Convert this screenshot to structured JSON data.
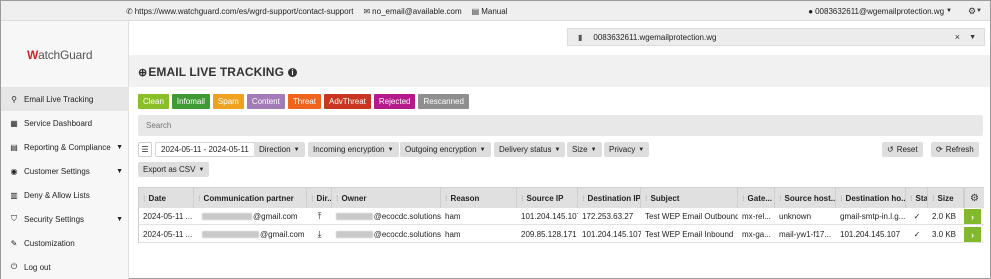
{
  "topbar": {
    "support_link": "https://www.watchguard.com/es/wgrd-support/contact-support",
    "email": "no_email@available.com",
    "manual": "Manual",
    "user": "0083632611@wgemailprotection.wg"
  },
  "logo": {
    "prefix": "W",
    "rest": "atchGuard"
  },
  "tenant": {
    "value": "0083632611.wgemailprotection.wg"
  },
  "sidebar": {
    "items": [
      {
        "label": "Email Live Tracking",
        "icon": "search-icon",
        "caret": false
      },
      {
        "label": "Service Dashboard",
        "icon": "dashboard-icon",
        "caret": false
      },
      {
        "label": "Reporting & Compliance",
        "icon": "reporting-icon",
        "caret": true
      },
      {
        "label": "Customer Settings",
        "icon": "user-settings-icon",
        "caret": true
      },
      {
        "label": "Deny & Allow Lists",
        "icon": "list-icon",
        "caret": false
      },
      {
        "label": "Security Settings",
        "icon": "shield-icon",
        "caret": true
      },
      {
        "label": "Customization",
        "icon": "brush-icon",
        "caret": false
      },
      {
        "label": "Log out",
        "icon": "power-icon",
        "caret": false
      }
    ]
  },
  "page": {
    "title": "EMAIL LIVE TRACKING"
  },
  "filters": [
    {
      "label": "Clean",
      "color": "#8bbf2a"
    },
    {
      "label": "Infomail",
      "color": "#3f9a35"
    },
    {
      "label": "Spam",
      "color": "#f0a21e"
    },
    {
      "label": "Content",
      "color": "#a37bb7"
    },
    {
      "label": "Threat",
      "color": "#f0631c"
    },
    {
      "label": "AdvThreat",
      "color": "#c9361f"
    },
    {
      "label": "Rejected",
      "color": "#b51a8a"
    },
    {
      "label": "Rescanned",
      "color": "#8f8f8f"
    }
  ],
  "search": {
    "placeholder": "Search"
  },
  "toolbar": {
    "date_range": "2024-05-11 - 2024-05-11",
    "direction": "Direction",
    "incoming": "Incoming encryption",
    "outgoing": "Outgoing encryption",
    "delivery": "Delivery status",
    "size": "Size",
    "privacy": "Privacy",
    "reset": "Reset",
    "refresh": "Refresh",
    "export": "Export as CSV"
  },
  "table": {
    "headers": [
      "Date",
      "Communication partner",
      "Dir...",
      "Owner",
      "Reason",
      "Source IP",
      "Destination IP",
      "Subject",
      "Gate...",
      "Source host...",
      "Destination ho...",
      "Sta...",
      "Size"
    ],
    "rows": [
      {
        "date": "2024-05-11 ...",
        "partner": "@gmail.com",
        "direction_icon": "upload-icon",
        "owner": "@ecocdc.solutions",
        "reason": "ham",
        "source_ip": "101.204.145.107",
        "dest_ip": "172.253.63.27",
        "subject": "Test WEP Email Outbound",
        "gateway": "mx-rel...",
        "source_host": "unknown",
        "dest_host": "gmail-smtp-in.l.g...",
        "status": "✓",
        "size": "2.0 KB"
      },
      {
        "date": "2024-05-11 ...",
        "partner": "@gmail.com",
        "direction_icon": "download-icon",
        "owner": "@ecocdc.solutions",
        "reason": "ham",
        "source_ip": "209.85.128.171",
        "dest_ip": "101.204.145.107",
        "subject": "Test WEP Email Inbound",
        "gateway": "mx-ga...",
        "source_host": "mail-yw1-f17...",
        "dest_host": "101.204.145.107",
        "status": "✓",
        "size": "3.0 KB"
      }
    ]
  }
}
